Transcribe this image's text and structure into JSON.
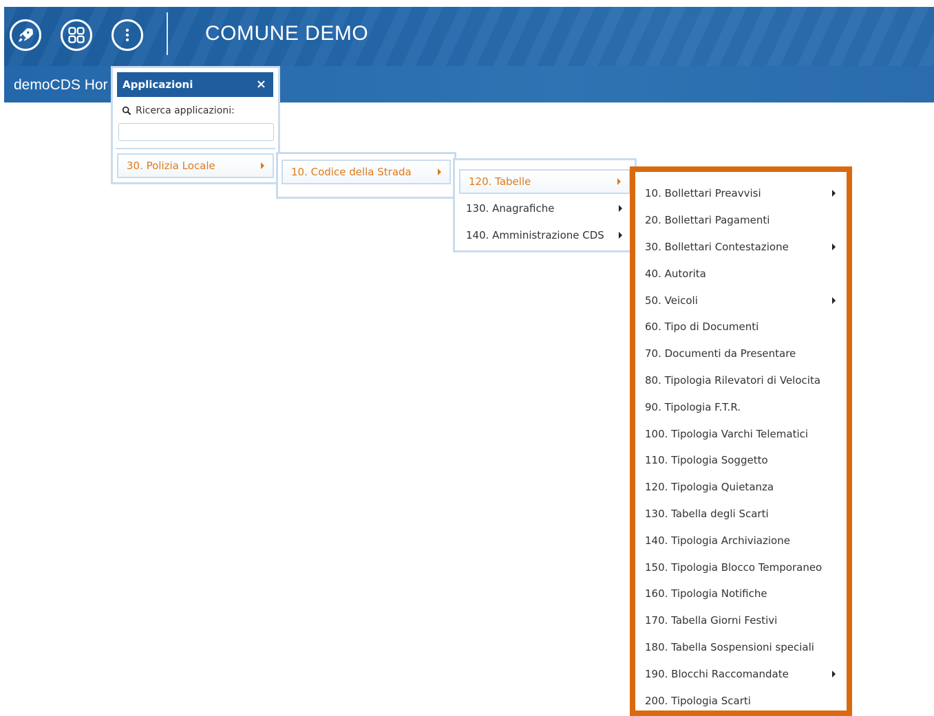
{
  "header": {
    "title": "COMUNE DEMO",
    "buttons": [
      {
        "icon": "rocket-icon"
      },
      {
        "icon": "apps-grid-icon"
      },
      {
        "icon": "more-vertical-icon"
      }
    ]
  },
  "subbar": {
    "text": "demoCDS Hor"
  },
  "app_panel": {
    "title": "Applicazioni",
    "close": "×",
    "search_label": "Ricerca applicazioni:",
    "search_value": "",
    "items": [
      {
        "label": "30. Polizia Locale",
        "has_sub": true,
        "active": true
      }
    ]
  },
  "level2": {
    "items": [
      {
        "label": "10. Codice della Strada",
        "has_sub": true,
        "active": true
      }
    ]
  },
  "level3": {
    "items": [
      {
        "label": "120. Tabelle",
        "has_sub": true,
        "active": true
      },
      {
        "label": "130. Anagrafiche",
        "has_sub": true,
        "active": false
      },
      {
        "label": "140. Amministrazione CDS",
        "has_sub": true,
        "active": false
      }
    ]
  },
  "level4": {
    "highlight_color": "#d96a10",
    "items": [
      {
        "label": "10. Bollettari Preavvisi",
        "has_sub": true
      },
      {
        "label": "20. Bollettari Pagamenti",
        "has_sub": false
      },
      {
        "label": "30. Bollettari Contestazione",
        "has_sub": true
      },
      {
        "label": "40. Autorita",
        "has_sub": false
      },
      {
        "label": "50. Veicoli",
        "has_sub": true
      },
      {
        "label": "60. Tipo di Documenti",
        "has_sub": false
      },
      {
        "label": "70. Documenti da Presentare",
        "has_sub": false
      },
      {
        "label": "80. Tipologia Rilevatori di Velocita",
        "has_sub": false
      },
      {
        "label": "90. Tipologia F.T.R.",
        "has_sub": false
      },
      {
        "label": "100. Tipologia Varchi Telematici",
        "has_sub": false
      },
      {
        "label": "110. Tipologia Soggetto",
        "has_sub": false
      },
      {
        "label": "120. Tipologia Quietanza",
        "has_sub": false
      },
      {
        "label": "130. Tabella degli Scarti",
        "has_sub": false
      },
      {
        "label": "140. Tipologia Archiviazione",
        "has_sub": false
      },
      {
        "label": "150. Tipologia Blocco Temporaneo",
        "has_sub": false
      },
      {
        "label": "160. Tipologia Notifiche",
        "has_sub": false
      },
      {
        "label": "170. Tabella Giorni Festivi",
        "has_sub": false
      },
      {
        "label": "180. Tabella Sospensioni speciali",
        "has_sub": false
      },
      {
        "label": "190. Blocchi Raccomandate",
        "has_sub": true
      },
      {
        "label": "200. Tipologia Scarti",
        "has_sub": false
      }
    ]
  }
}
